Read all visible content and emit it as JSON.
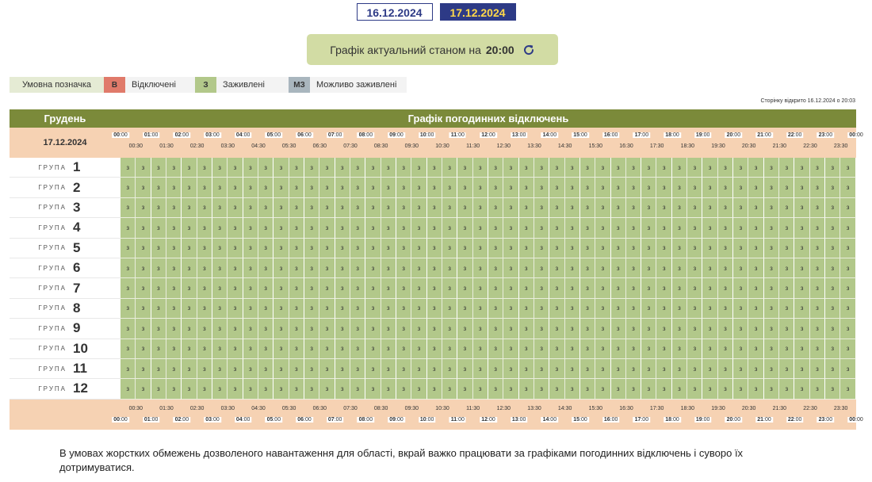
{
  "date_tabs": [
    "16.12.2024",
    "17.12.2024"
  ],
  "active_tab": 1,
  "status": {
    "text": "Графік актуальний станом на",
    "time": "20:00"
  },
  "legend": {
    "title": "Умовна позначка",
    "items": [
      {
        "code": "В",
        "label": "Відключені",
        "color": "#e07a6a"
      },
      {
        "code": "З",
        "label": "Заживлені",
        "color": "#b2c88a"
      },
      {
        "code": "МЗ",
        "label": "Можливо заживлені",
        "color": "#a9b6be"
      }
    ]
  },
  "opened_text": "Сторінку відкрито 16.12.2024 о 20:03",
  "schedule": {
    "month": "Грудень",
    "title": "Графік погодинних відключень",
    "date": "17.12.2024",
    "group_word": "ГРУПА",
    "hours": [
      "00",
      "01",
      "02",
      "03",
      "04",
      "05",
      "06",
      "07",
      "08",
      "09",
      "10",
      "11",
      "12",
      "13",
      "14",
      "15",
      "16",
      "17",
      "18",
      "19",
      "20",
      "21",
      "22",
      "23",
      "00"
    ],
    "minutes_suffix": ":00",
    "half_hours": [
      "00:30",
      "01:30",
      "02:30",
      "03:30",
      "04:30",
      "05:30",
      "06:30",
      "07:30",
      "08:30",
      "09:30",
      "10:30",
      "11:30",
      "12:30",
      "13:30",
      "14:30",
      "15:30",
      "16:30",
      "17:30",
      "18:30",
      "19:30",
      "20:30",
      "21:30",
      "22:30",
      "23:30"
    ],
    "groups": [
      {
        "num": "1",
        "status": "З"
      },
      {
        "num": "2",
        "status": "З"
      },
      {
        "num": "3",
        "status": "З"
      },
      {
        "num": "4",
        "status": "З"
      },
      {
        "num": "5",
        "status": "З"
      },
      {
        "num": "6",
        "status": "З"
      },
      {
        "num": "7",
        "status": "З"
      },
      {
        "num": "8",
        "status": "З"
      },
      {
        "num": "9",
        "status": "З"
      },
      {
        "num": "10",
        "status": "З"
      },
      {
        "num": "11",
        "status": "З"
      },
      {
        "num": "12",
        "status": "З"
      }
    ],
    "cell_value": "з"
  },
  "note": "В умовах жорстких обмежень дозволеного навантаження для області, вкрай важко працювати за графіками погодинних відключень і суворо їх дотримуватися."
}
